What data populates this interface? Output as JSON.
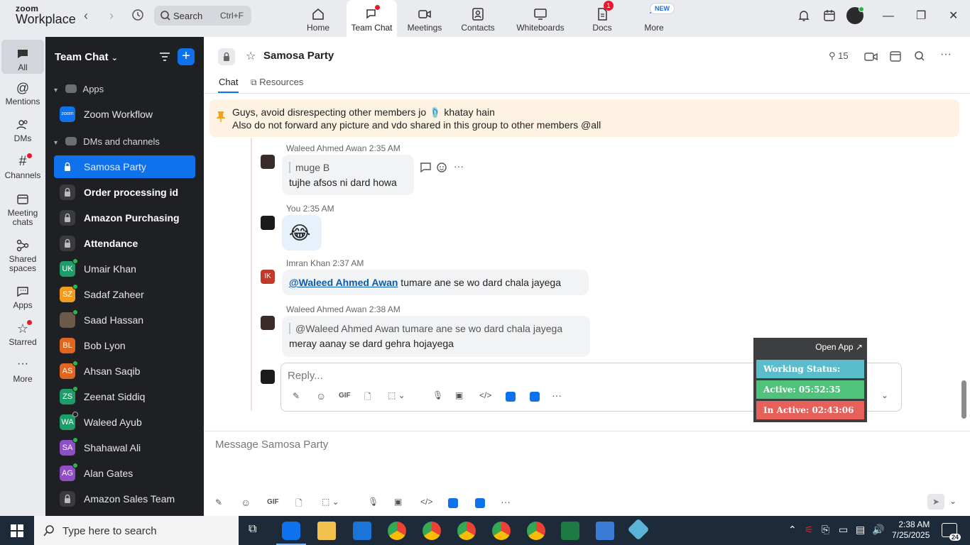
{
  "app": {
    "logo_line1": "zoom",
    "logo_line2": "Workplace",
    "search_placeholder": "Search",
    "search_shortcut": "Ctrl+F",
    "tabs": [
      {
        "label": "Home"
      },
      {
        "label": "Team Chat",
        "active": true
      },
      {
        "label": "Meetings"
      },
      {
        "label": "Contacts"
      },
      {
        "label": "Whiteboards"
      },
      {
        "label": "Docs",
        "badge": "1"
      },
      {
        "label": "More",
        "badge": "NEW"
      }
    ]
  },
  "rail": {
    "items": [
      {
        "label": "All",
        "icon": "chat-bubble-icon"
      },
      {
        "label": "Mentions",
        "icon": "at-icon"
      },
      {
        "label": "DMs",
        "icon": "people-icon"
      },
      {
        "label": "Channels",
        "icon": "hash-icon"
      },
      {
        "label": "Meeting chats",
        "icon": "calendar-icon"
      },
      {
        "label": "Shared spaces",
        "icon": "share-icon"
      },
      {
        "label": "Apps",
        "icon": "apps-icon"
      },
      {
        "label": "Starred",
        "icon": "star-icon"
      },
      {
        "label": "More",
        "icon": "more-icon"
      }
    ]
  },
  "sidebar": {
    "title": "Team Chat",
    "sections": {
      "apps": "Apps",
      "dms": "DMs and channels"
    },
    "apps": [
      {
        "name": "Zoom Workflow",
        "avatar": "zoom",
        "color": "#0e72ed"
      }
    ],
    "items": [
      {
        "name": "Samosa Party",
        "type": "channel",
        "selected": true
      },
      {
        "name": "Order processing id",
        "type": "channel",
        "bold": true
      },
      {
        "name": "Amazon Purchasing",
        "type": "channel",
        "bold": true
      },
      {
        "name": "Attendance",
        "type": "channel",
        "bold": true
      },
      {
        "name": "Umair Khan",
        "initials": "UK",
        "color": "#1e9c6a"
      },
      {
        "name": "Sadaf Zaheer",
        "initials": "SZ",
        "color": "#f29b1d"
      },
      {
        "name": "Saad Hassan",
        "initials": "",
        "color": "#6b5a4a"
      },
      {
        "name": "Bob Lyon",
        "initials": "BL",
        "color": "#e0651e"
      },
      {
        "name": "Ahsan Saqib",
        "initials": "AS",
        "color": "#e0651e"
      },
      {
        "name": "Zeenat Siddiq",
        "initials": "ZS",
        "color": "#1e9c6a"
      },
      {
        "name": "Waleed Ayub",
        "initials": "WA",
        "color": "#1e9c6a"
      },
      {
        "name": "Shahawal Ali",
        "initials": "SA",
        "color": "#8e4fc4"
      },
      {
        "name": "Alan Gates",
        "initials": "AG",
        "color": "#8e4fc4"
      },
      {
        "name": "Amazon Sales Team",
        "type": "channel"
      }
    ]
  },
  "channel": {
    "title": "Samosa Party",
    "member_count": "15",
    "tabs": {
      "chat": "Chat",
      "resources": "Resources"
    },
    "pinned_line1": "Guys, avoid disrespecting other members jo 🩴 khatay hain",
    "pinned_line2": "Also do not forward any picture and vdo shared in this group to other members @all"
  },
  "messages": [
    {
      "author": "Waleed Ahmed Awan",
      "time": "2:35 AM",
      "quote": "muge B",
      "text": "tujhe afsos ni dard howa"
    },
    {
      "author": "You",
      "time": "2:35 AM",
      "text": "😂"
    },
    {
      "author": "Imran Khan",
      "time": "2:37 AM",
      "initials": "IK",
      "mention": "@Waleed Ahmed Awan",
      "text": " tumare ane se wo dard chala jayega"
    },
    {
      "author": "Waleed Ahmed Awan",
      "time": "2:38 AM",
      "quote": "@Waleed Ahmed Awan tumare ane se wo dard chala jayega",
      "text": "meray aanay se dard gehra hojayega"
    }
  ],
  "composer": {
    "reply_placeholder": "Reply...",
    "message_placeholder": "Message Samosa Party",
    "gif": "GIF"
  },
  "widget": {
    "open_app": "Open App ↗",
    "working_status": "Working Status: Active",
    "active": "Active: 05:52:35",
    "inactive": "In Active: 02:43:06",
    "colors": {
      "status": "#5bbccb",
      "active": "#4fc37a",
      "inactive": "#e8605a"
    }
  },
  "taskbar": {
    "search_placeholder": "Type here to search",
    "time": "2:38 AM",
    "date": "7/25/2025",
    "notification_count": "24"
  }
}
